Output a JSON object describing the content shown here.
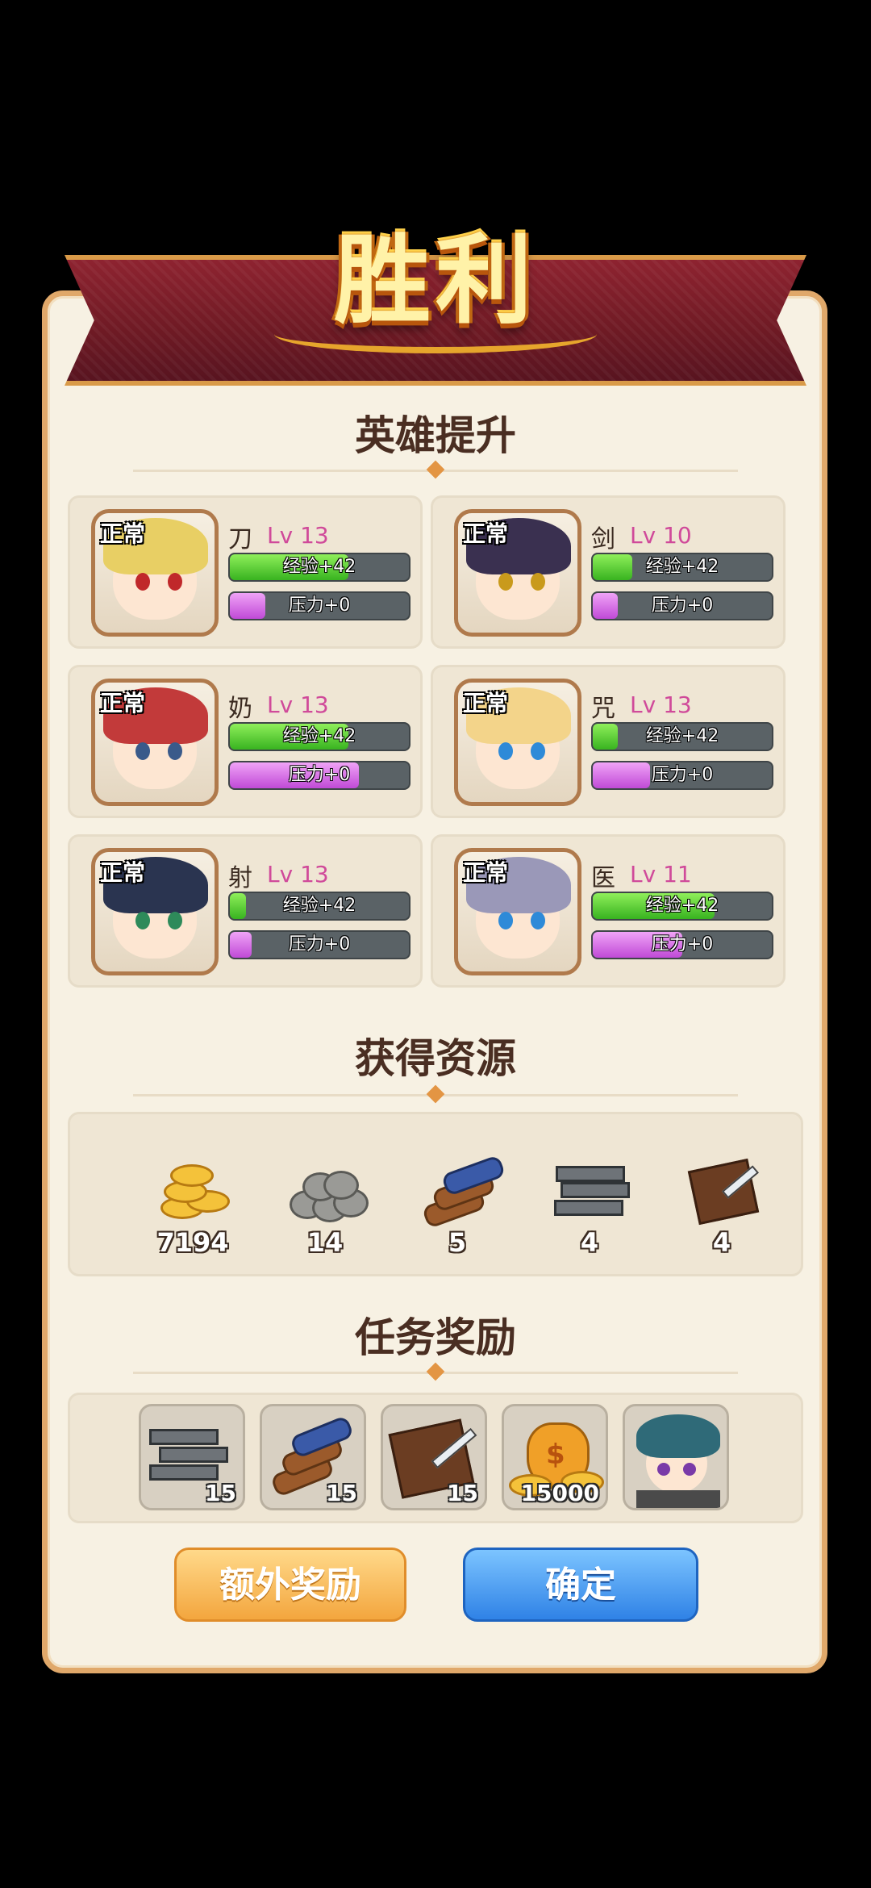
{
  "title": "胜利",
  "sections": {
    "heroes": "英雄提升",
    "resources": "获得资源",
    "quest_rewards": "任务奖励"
  },
  "heroes": [
    {
      "status": "正常",
      "name": "刀",
      "level": "Lv 13",
      "exp_text": "经验+42",
      "exp_fill": 0.66,
      "stress_text": "压力+0",
      "stress_fill": 0.2,
      "hair": "#e8cf64",
      "eye": "#c0282a"
    },
    {
      "status": "正常",
      "name": "剑",
      "level": "Lv 10",
      "exp_text": "经验+42",
      "exp_fill": 0.22,
      "stress_text": "压力+0",
      "stress_fill": 0.14,
      "hair": "#3a3050",
      "eye": "#c99a1c"
    },
    {
      "status": "正常",
      "name": "奶",
      "level": "Lv 13",
      "exp_text": "经验+42",
      "exp_fill": 0.66,
      "stress_text": "压力+0",
      "stress_fill": 0.72,
      "hair": "#c23a3a",
      "eye": "#3a5a8a"
    },
    {
      "status": "正常",
      "name": "咒",
      "level": "Lv 13",
      "exp_text": "经验+42",
      "exp_fill": 0.14,
      "stress_text": "压力+0",
      "stress_fill": 0.32,
      "hair": "#f3d48a",
      "eye": "#2e8ad8"
    },
    {
      "status": "正常",
      "name": "射",
      "level": "Lv 13",
      "exp_text": "经验+42",
      "exp_fill": 0.09,
      "stress_text": "压力+0",
      "stress_fill": 0.12,
      "hair": "#2a3450",
      "eye": "#2e8a5a"
    },
    {
      "status": "正常",
      "name": "医",
      "level": "Lv 11",
      "exp_text": "经验+42",
      "exp_fill": 0.68,
      "stress_text": "压力+0",
      "stress_fill": 0.5,
      "hair": "#9a98b8",
      "eye": "#2e8ad8"
    }
  ],
  "resources": [
    {
      "icon": "gold-coins-icon",
      "count": "7194"
    },
    {
      "icon": "stone-icon",
      "count": "14"
    },
    {
      "icon": "wood-logs-icon",
      "count": "5"
    },
    {
      "icon": "iron-ingot-icon",
      "count": "4"
    },
    {
      "icon": "leather-icon",
      "count": "4"
    }
  ],
  "rewards": [
    {
      "icon": "iron-ingot-icon",
      "count": "15"
    },
    {
      "icon": "wood-logs-icon",
      "count": "15"
    },
    {
      "icon": "leather-icon",
      "count": "15"
    },
    {
      "icon": "money-bag-icon",
      "count": "15000"
    },
    {
      "icon": "hero-portrait-icon",
      "count": ""
    }
  ],
  "buttons": {
    "extra": "额外奖励",
    "confirm": "确定"
  }
}
